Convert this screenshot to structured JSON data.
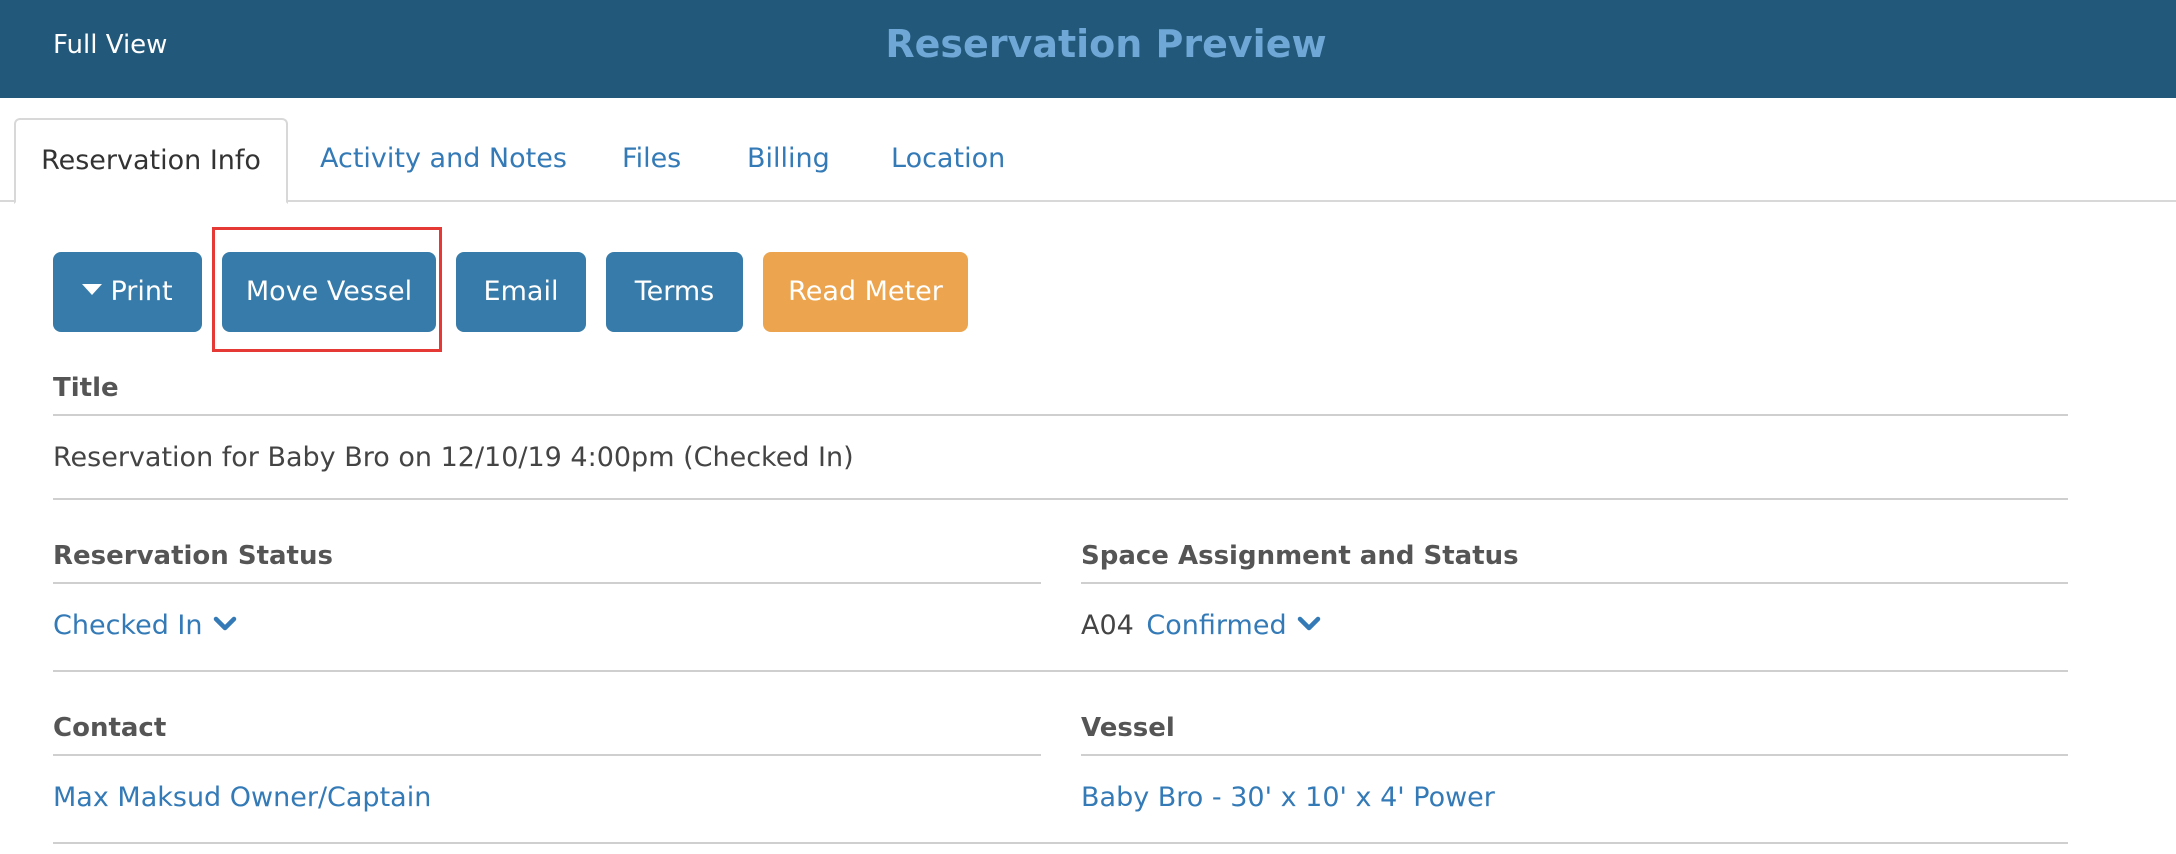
{
  "header": {
    "full_view_label": "Full View",
    "title": "Reservation Preview"
  },
  "tabs": [
    {
      "label": "Reservation Info",
      "active": true
    },
    {
      "label": "Activity and Notes",
      "active": false
    },
    {
      "label": "Files",
      "active": false
    },
    {
      "label": "Billing",
      "active": false
    },
    {
      "label": "Location",
      "active": false
    }
  ],
  "toolbar": {
    "print_label": "Print",
    "move_vessel_label": "Move Vessel",
    "email_label": "Email",
    "terms_label": "Terms",
    "read_meter_label": "Read Meter",
    "highlighted_button": "Move Vessel"
  },
  "sections": {
    "title": {
      "label": "Title",
      "value": "Reservation for Baby Bro on 12/10/19 4:00pm (Checked In)"
    },
    "reservation_status": {
      "label": "Reservation Status",
      "value": "Checked In"
    },
    "space_assignment": {
      "label": "Space Assignment and Status",
      "space": "A04",
      "status": "Confirmed"
    },
    "contact": {
      "label": "Contact",
      "value": "Max Maksud Owner/Captain"
    },
    "vessel": {
      "label": "Vessel",
      "value": "Baby Bro - 30' x 10' x 4' Power"
    }
  },
  "colors": {
    "header_bg": "#22587a",
    "header_title": "#6fa8d6",
    "button_blue": "#367ba9",
    "button_orange": "#eca54e",
    "link": "#337ab7",
    "highlight": "#e53935"
  }
}
